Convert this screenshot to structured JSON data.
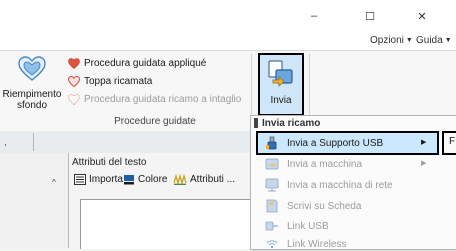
{
  "window": {
    "minimize_glyph": "–",
    "maximize_glyph": "☐",
    "close_glyph": "✕"
  },
  "menu": {
    "options_label": "Opzioni",
    "help_label": "Guida"
  },
  "ribbon": {
    "background_fill": {
      "label_line1": "Riempimento",
      "label_line2": "sfondo",
      "icon": "fill-heart-icon"
    },
    "items": [
      {
        "label": "Procedura guidata appliqué",
        "icon": "heart-icon",
        "disabled": false
      },
      {
        "label": "Toppa ricamata",
        "icon": "heart-outline-icon",
        "disabled": false
      },
      {
        "label": "Procedura guidata ricamo a intaglio",
        "icon": "cutwork-icon",
        "disabled": true
      }
    ],
    "group_label": "Procedure guidate",
    "send_button": {
      "label": "Invia",
      "icon": "send-icon"
    }
  },
  "text_panel": {
    "title": "Attributi del testo",
    "import_label": "Importa",
    "color_label": "Colore",
    "attributes_label": "Attributi ..."
  },
  "send_menu": {
    "header": "Invia ricamo",
    "items": [
      {
        "label": "Invia a Supporto USB",
        "icon": "usb-icon",
        "disabled": false,
        "submenu": true
      },
      {
        "label": "Invia a macchina",
        "icon": "machine-icon",
        "disabled": true,
        "submenu": true
      },
      {
        "label": "Invia a macchina di rete",
        "icon": "network-machine-icon",
        "disabled": true,
        "submenu": false
      },
      {
        "label": "Scrivi su Scheda",
        "icon": "card-icon",
        "disabled": true,
        "submenu": false
      },
      {
        "label": "Link USB",
        "icon": "link-usb-icon",
        "disabled": true,
        "submenu": false
      },
      {
        "label": "Link Wireless",
        "icon": "wireless-icon",
        "disabled": true,
        "submenu": false
      }
    ],
    "submenu_drive": "F:"
  },
  "colors": {
    "highlight": "#cce8ff",
    "accent_border": "#000000",
    "disabled_text": "#9c9c9c"
  }
}
